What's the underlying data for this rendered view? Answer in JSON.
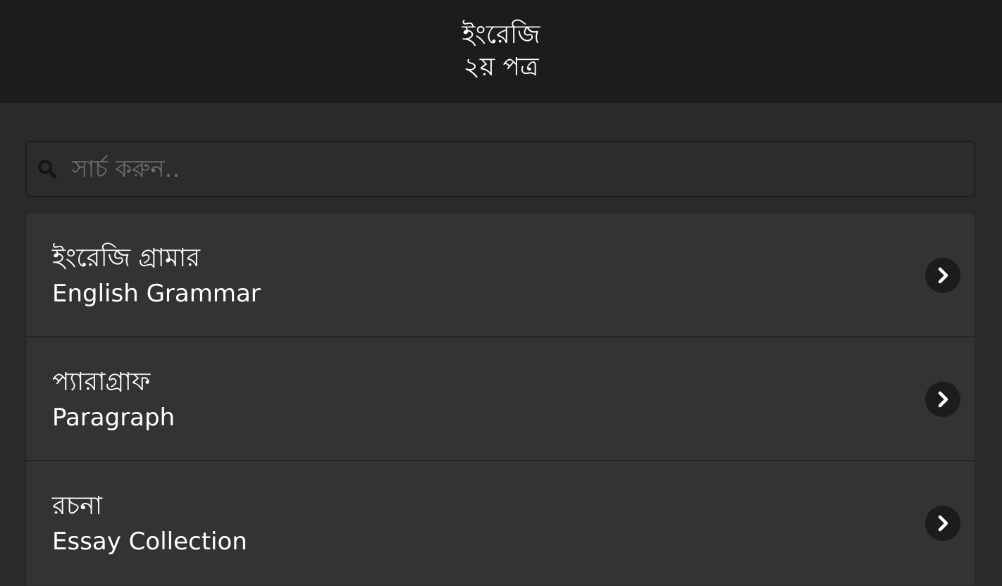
{
  "header": {
    "title_line1": "ইংরেজি",
    "title_line2": "২য় পত্র"
  },
  "search": {
    "placeholder": "সার্চ করুন..",
    "value": ""
  },
  "icons": {
    "search": "search-icon",
    "chevron": "chevron-right-icon"
  },
  "colors": {
    "header_bg": "#1c1c1c",
    "page_bg": "#2a2a2a",
    "list_bg": "#333333",
    "text": "#ffffff",
    "placeholder": "#6d6d6d"
  },
  "items": [
    {
      "title": "ইংরেজি গ্রামার",
      "subtitle": "English Grammar"
    },
    {
      "title": "প্যারাগ্রাফ",
      "subtitle": "Paragraph"
    },
    {
      "title": "রচনা",
      "subtitle": "Essay Collection"
    }
  ]
}
